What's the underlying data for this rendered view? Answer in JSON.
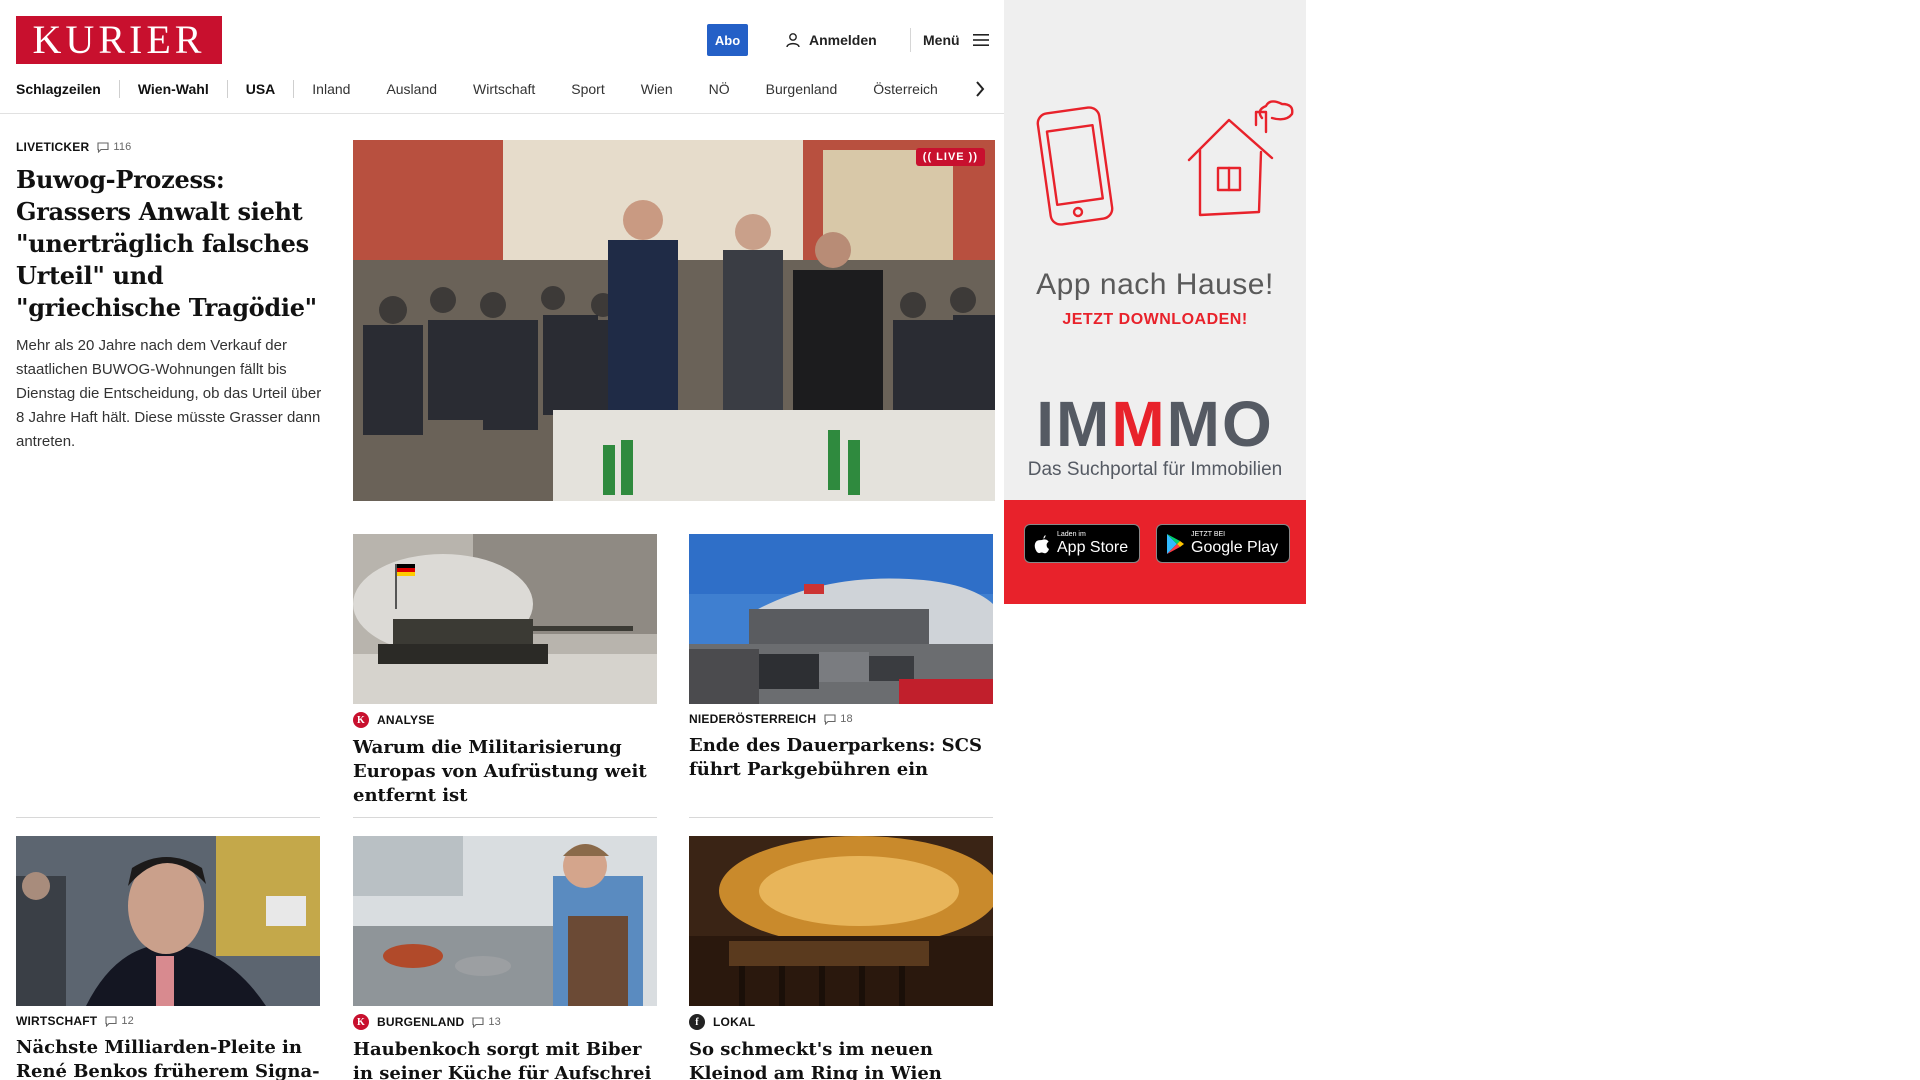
{
  "header": {
    "logo": "KURIER",
    "abo_label": "Abo",
    "login_label": "Anmelden",
    "menu_label": "Menü"
  },
  "nav": [
    "Schlagzeilen",
    "Wien-Wahl",
    "USA",
    "Inland",
    "Ausland",
    "Wirtschaft",
    "Sport",
    "Wien",
    "NÖ",
    "Burgenland",
    "Österreich"
  ],
  "lead": {
    "kicker": "LIVETICKER",
    "comments": "116",
    "headline": "Buwog-Prozess: Grassers Anwalt sieht \"unerträglich falsches Urteil\" und \"griechische Tragödie\"",
    "teaser": "Mehr als 20 Jahre nach dem Verkauf der staatlichen BUWOG-Wohnungen fällt bis Dienstag die Entscheidung, ob das Urteil über 8 Jahre Haft hält. Diese müsste Grasser dann antreten.",
    "live_badge": "(( LIVE ))"
  },
  "cards": [
    {
      "kicker": "ANALYSE",
      "badge": "K",
      "comments": "",
      "headline": "Warum die Militarisierung Europas von Aufrüstung weit entfernt ist"
    },
    {
      "kicker": "NIEDERÖSTERREICH",
      "badge": "",
      "comments": "18",
      "headline": "Ende des Dauerparkens: SCS führt Parkgebühren ein"
    },
    {
      "kicker": "WIRTSCHAFT",
      "badge": "",
      "comments": "12",
      "headline": "Nächste Milliarden-Pleite in René Benkos früherem Signa-Imperium"
    },
    {
      "kicker": "BURGENLAND",
      "badge": "K",
      "comments": "13",
      "headline": "Haubenkoch sorgt mit Biber in seiner Küche für Aufschrei"
    },
    {
      "kicker": "LOKAL",
      "badge": "f",
      "comments": "",
      "headline": "So schmeckt's im neuen Kleinod am Ring in Wien"
    }
  ],
  "ad": {
    "title": "App nach Hause!",
    "cta": "JETZT DOWNLOADEN!",
    "brand_a": "IM",
    "brand_b": "M",
    "brand_c": "MO",
    "tagline": "Das Suchportal für Immobilien",
    "appstore_small": "Laden im",
    "appstore_big": "App Store",
    "googleplay_small": "JETZT BEI",
    "googleplay_big": "Google Play"
  },
  "colors": {
    "brand_red": "#c8102e",
    "abo_blue": "#2460c7",
    "ad_red": "#e8222b"
  }
}
